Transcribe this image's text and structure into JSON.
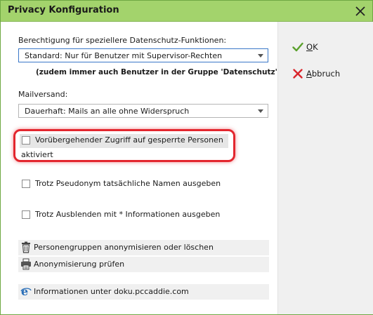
{
  "window": {
    "title": "Privacy Konfiguration"
  },
  "permission": {
    "label": "Berechtigung für speziellere Datenschutz-Funktionen:",
    "selected": "Standard: Nur für Benutzer mit Supervisor-Rechten",
    "note": "(zudem immer auch Benutzer in der Gruppe 'Datenschutz')"
  },
  "mail": {
    "label": "Mailversand:",
    "selected": "Dauerhaft: Mails an alle ohne Widerspruch"
  },
  "checkboxes": {
    "temporary_access_line1": "Vorübergehender Zugriff auf gesperrte Personen",
    "temporary_access_line2": "aktiviert",
    "pseudonym": "Trotz Pseudonym tatsächliche Namen ausgeben",
    "hide": "Trotz Ausblenden mit * Informationen ausgeben"
  },
  "actions": {
    "anonymize": "Personengruppen anonymisieren oder löschen",
    "check": "Anonymisierung prüfen",
    "info": "Informationen unter doku.pccaddie.com"
  },
  "buttons": {
    "ok_accel": "O",
    "ok_rest": "K",
    "cancel_accel": "A",
    "cancel_rest": "bbruch"
  },
  "colors": {
    "titlebar": "#a3d36c",
    "highlight": "#e3262e",
    "ok_icon": "#5aa02c",
    "cancel_icon": "#d9262c"
  }
}
